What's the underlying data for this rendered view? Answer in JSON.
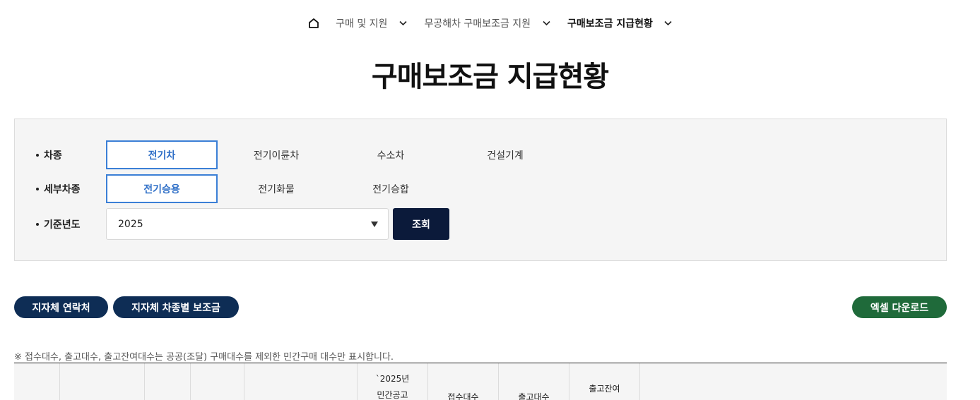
{
  "breadcrumb": {
    "items": [
      "구매 및 지원",
      "무공해차 구매보조금 지원",
      "구매보조금 지급현황"
    ]
  },
  "page_title": "구매보조금 지급현황",
  "filters": {
    "vehicle_type": {
      "label": "차종",
      "options": [
        "전기차",
        "전기이륜차",
        "수소차",
        "건설기계"
      ],
      "selected": "전기차"
    },
    "sub_type": {
      "label": "세부차종",
      "options": [
        "전기승용",
        "전기화물",
        "전기승합"
      ],
      "selected": "전기승용"
    },
    "year": {
      "label": "기준년도",
      "value": "2025"
    },
    "search_label": "조회"
  },
  "buttons": {
    "local_contacts": "지자체 연락처",
    "local_subsidy": "지자체 차종별 보조금",
    "excel_download": "엑셀 다운로드"
  },
  "notice": "※ 접수대수, 출고대수, 출고잔여대수는 공공(조달) 구매대수를 제외한 민간구매 대수만 표시합니다.",
  "table": {
    "headers": [
      "",
      "",
      "",
      "",
      "",
      "`2025년\n민간공고",
      "접수대수",
      "출고대수",
      "출고잔여",
      ""
    ]
  },
  "colors": {
    "active_blue": "#3b7fd6",
    "navy": "#0e2d55",
    "search_dark": "#0b1a3a",
    "green": "#1f6a3a"
  }
}
